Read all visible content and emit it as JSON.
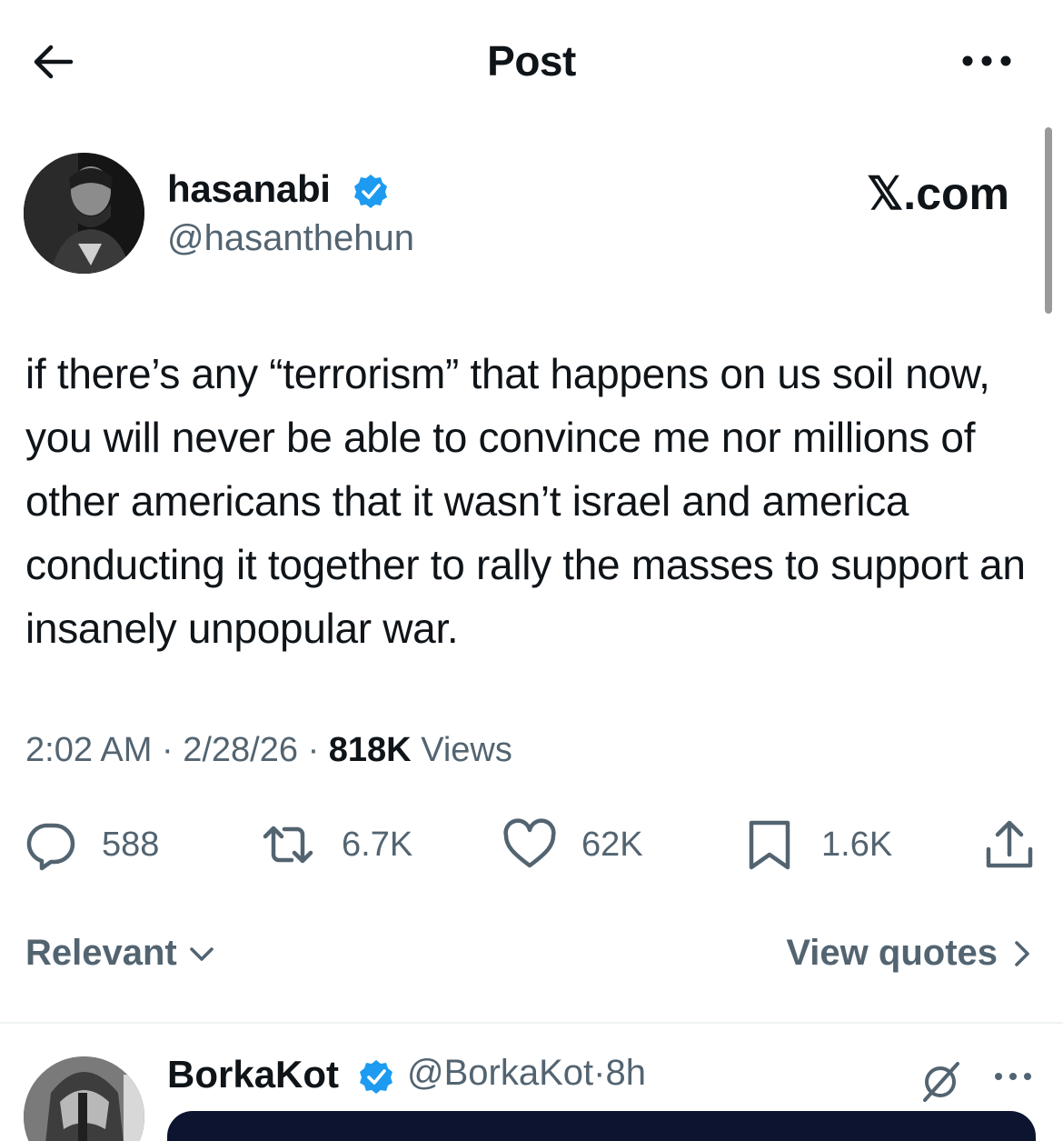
{
  "header": {
    "title": "Post",
    "back_icon": "arrow-left-icon",
    "more_icon": "more-horizontal-icon"
  },
  "post": {
    "author": {
      "display_name": "hasanabi",
      "handle": "@hasanthehun",
      "verified": true,
      "badge_text": "𝕏.com"
    },
    "text": "if there’s any “terrorism” that happens on us soil now, you will never be able to convince me nor millions of other americans that it wasn’t israel and america conducting it together to rally the masses to support an insanely unpopular war.",
    "time": "2:02 AM",
    "date": "2/28/26",
    "views_count": "818K",
    "views_label": "Views",
    "separator": "·",
    "stats": {
      "replies": "588",
      "reposts": "6.7K",
      "likes": "62K",
      "bookmarks": "1.6K"
    }
  },
  "sort": {
    "label": "Relevant",
    "view_quotes_label": "View quotes"
  },
  "reply": {
    "display_name": "BorkaKot",
    "handle": "@BorkaKot",
    "separator": "·",
    "age": "8h",
    "verified": true
  },
  "colors": {
    "text_primary": "#0f1419",
    "text_secondary": "#536471",
    "verified_blue": "#1d9bf0",
    "divider": "#eff3f4"
  }
}
